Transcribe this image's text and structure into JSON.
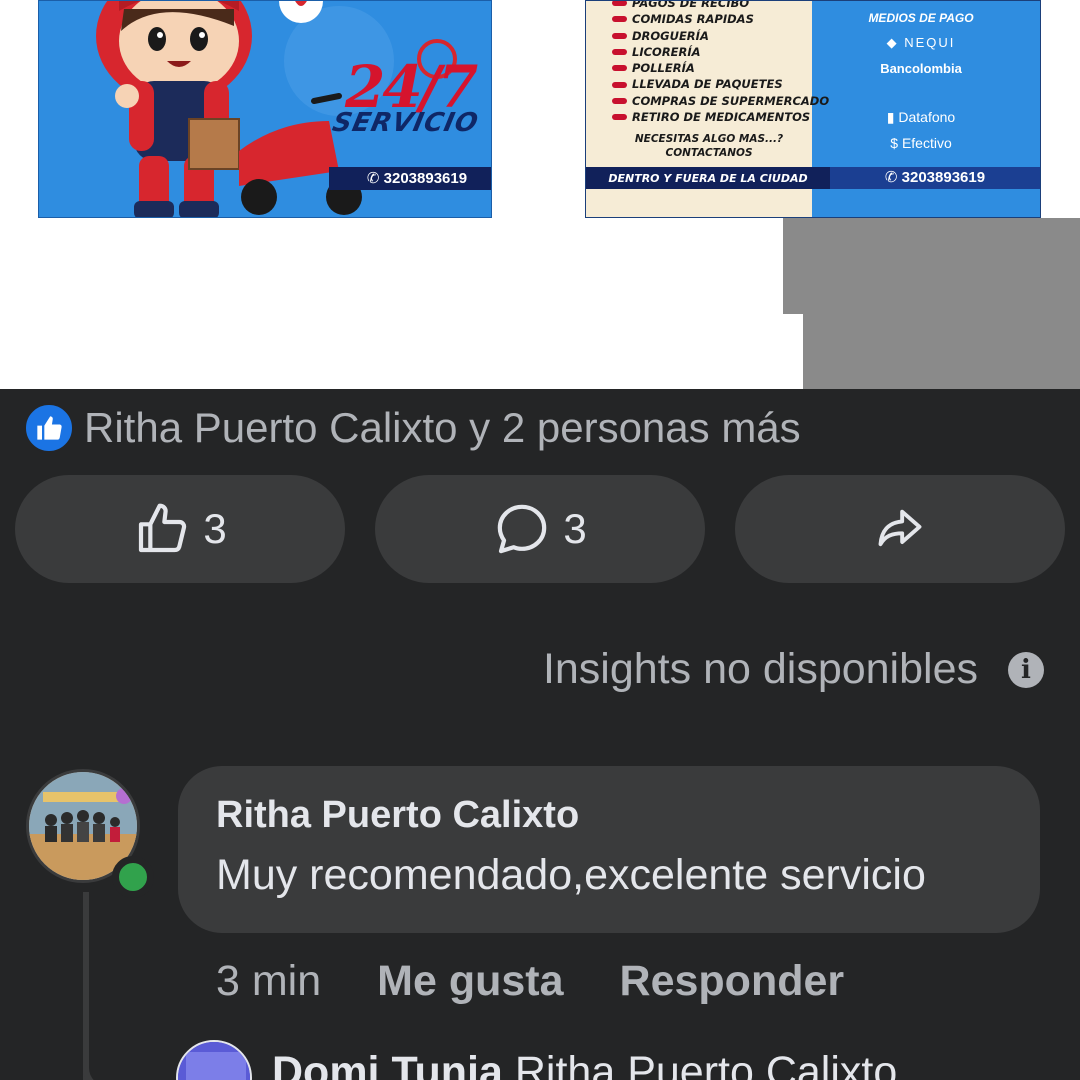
{
  "post_image": {
    "left_card": {
      "phone": "3203893619",
      "badge": "24/7",
      "badge_sub": "SERVICIO"
    },
    "right_card": {
      "services": [
        "PAGOS DE RECIBO",
        "COMIDAS RAPIDAS",
        "DROGUERÍA",
        "LICORERÍA",
        "POLLERÍA",
        "LLEVADA DE PAQUETES",
        "COMPRAS DE SUPERMERCADO",
        "RETIRO DE MEDICAMENTOS"
      ],
      "need_more_line1": "NECESITAS ALGO MAS...?",
      "need_more_line2": "CONTACTANOS",
      "payment_title": "MEDIOS DE PAGO",
      "payment_methods": [
        "NEQUI",
        "Bancolombia",
        "Datafono",
        "Efectivo"
      ],
      "footer_left": "DENTRO Y FUERA DE LA CIUDAD",
      "phone": "3203893619"
    }
  },
  "reactions": {
    "summary": "Ritha Puerto Calixto y 2 personas más"
  },
  "actions": {
    "like_count": "3",
    "comment_count": "3"
  },
  "insights": {
    "text": "Insights no disponibles"
  },
  "comment": {
    "author": "Ritha Puerto Calixto",
    "text": "Muy recomendado,excelente servicio",
    "time": "3 min",
    "like_label": "Me gusta",
    "reply_label": "Responder"
  },
  "reply_preview": {
    "author": "Domi Tunja",
    "mention": "Ritha Puerto Calixto"
  },
  "colors": {
    "background": "#242526",
    "surface": "#3a3b3c",
    "primary_text": "#e4e6eb",
    "secondary_text": "#b0b3b8",
    "like_blue": "#1b74e4",
    "online_green": "#31a24c"
  }
}
